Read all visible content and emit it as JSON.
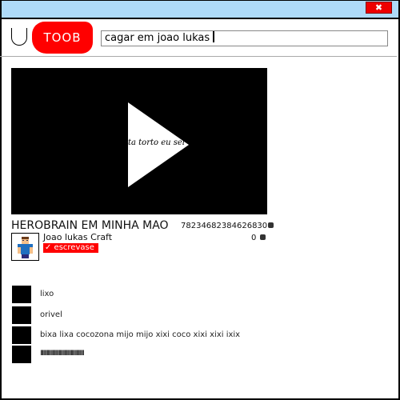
{
  "window": {
    "close_label": "✖"
  },
  "logo": {
    "text": "TOOB"
  },
  "search": {
    "value": "cagar em joao lukas"
  },
  "video": {
    "overlay_text": "ta torto eu sei",
    "title": "HEROBRAIN EM MINHA MAO",
    "views": "78234682384626830",
    "likes": "0"
  },
  "channel": {
    "name": "Joao lukas Craft",
    "subscribe_label": "✓ escrevase"
  },
  "colors": {
    "titlebar": "#aedaf8",
    "brand_red": "#ff0000"
  },
  "comments": [
    {
      "text": "lixo"
    },
    {
      "text": "orivel"
    },
    {
      "text": "bixa lixa cocozona mijo mijo xixi coco xixi xixi ixix"
    },
    {
      "text": "IIIIIIIIIIIIIIIIIIIIIIIIIIIIIIIIIIIIIIIIIIIIIII"
    }
  ]
}
